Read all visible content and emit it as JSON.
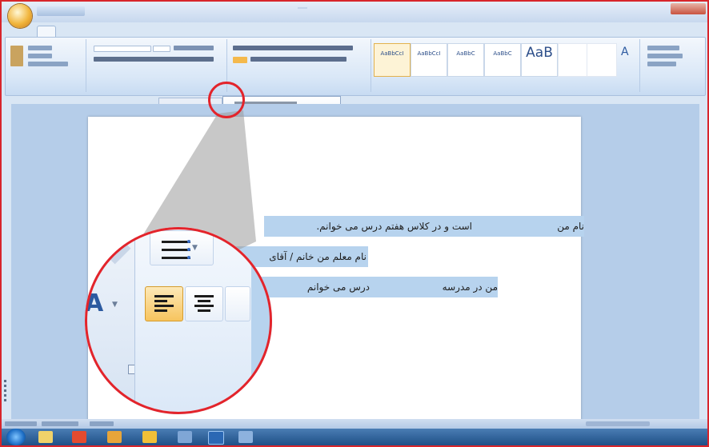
{
  "window": {
    "title": ""
  },
  "ribbon": {
    "styles": [
      {
        "sample": "AaBbCcI",
        "name": "",
        "selected": true
      },
      {
        "sample": "AaBbCcI",
        "name": "",
        "selected": false
      },
      {
        "sample": "AaBbC",
        "name": "",
        "selected": false
      },
      {
        "sample": "AaBbC",
        "name": "",
        "selected": false
      },
      {
        "sample": "AaB",
        "name": "",
        "selected": false,
        "large": true
      }
    ]
  },
  "document": {
    "lines": [
      {
        "right_text": "نام من",
        "middle_text": "است و در کلاس هفتم درس می خوانم."
      },
      {
        "right_text": "نام معلم من خانم / آقای"
      },
      {
        "right_text": "من در مدرسه",
        "middle_text": "درس می خوانم"
      }
    ]
  },
  "magnifier": {
    "align_left_active": true,
    "font_color_letter": "A"
  },
  "colors": {
    "highlight": "#b7d3ee",
    "circle": "#e3242b",
    "active_button": "#f7c45e"
  },
  "icons": [
    "office-button-icon",
    "align-left-icon",
    "center-icon",
    "bullets-icon",
    "font-color-icon",
    "dialog-launcher-icon",
    "start-icon"
  ]
}
